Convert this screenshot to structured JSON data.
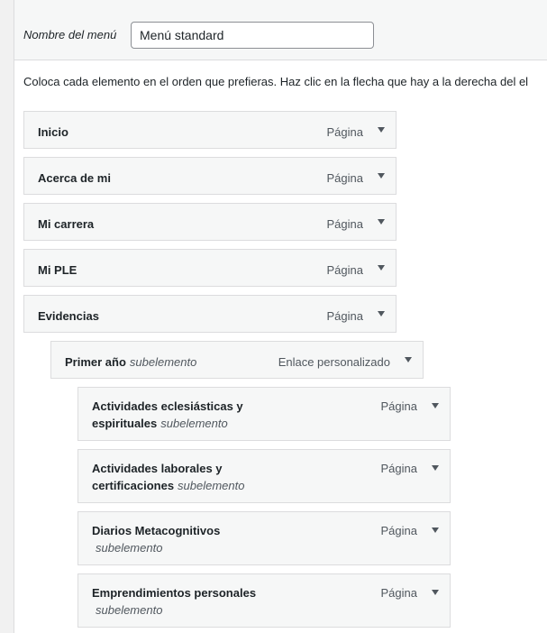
{
  "menu_name": {
    "label": "Nombre del menú",
    "value": "Menú standard"
  },
  "instructions": "Coloca cada elemento en el orden que prefieras. Haz clic en la flecha que hay a la derecha del el",
  "sub_label": "subelemento",
  "items": [
    {
      "title": "Inicio",
      "type": "Página"
    },
    {
      "title": "Acerca de mi",
      "type": "Página"
    },
    {
      "title": "Mi carrera",
      "type": "Página"
    },
    {
      "title": "Mi PLE",
      "type": "Página"
    },
    {
      "title": "Evidencias",
      "type": "Página"
    },
    {
      "title": "Primer año",
      "type": "Enlace personalizado"
    },
    {
      "title": "Actividades eclesiásticas y espirituales",
      "type": "Página"
    },
    {
      "title": "Actividades laborales y certificaciones",
      "type": "Página"
    },
    {
      "title": "Diarios Metacognitivos",
      "type": "Página"
    },
    {
      "title": "Emprendimientos personales",
      "type": "Página"
    }
  ]
}
